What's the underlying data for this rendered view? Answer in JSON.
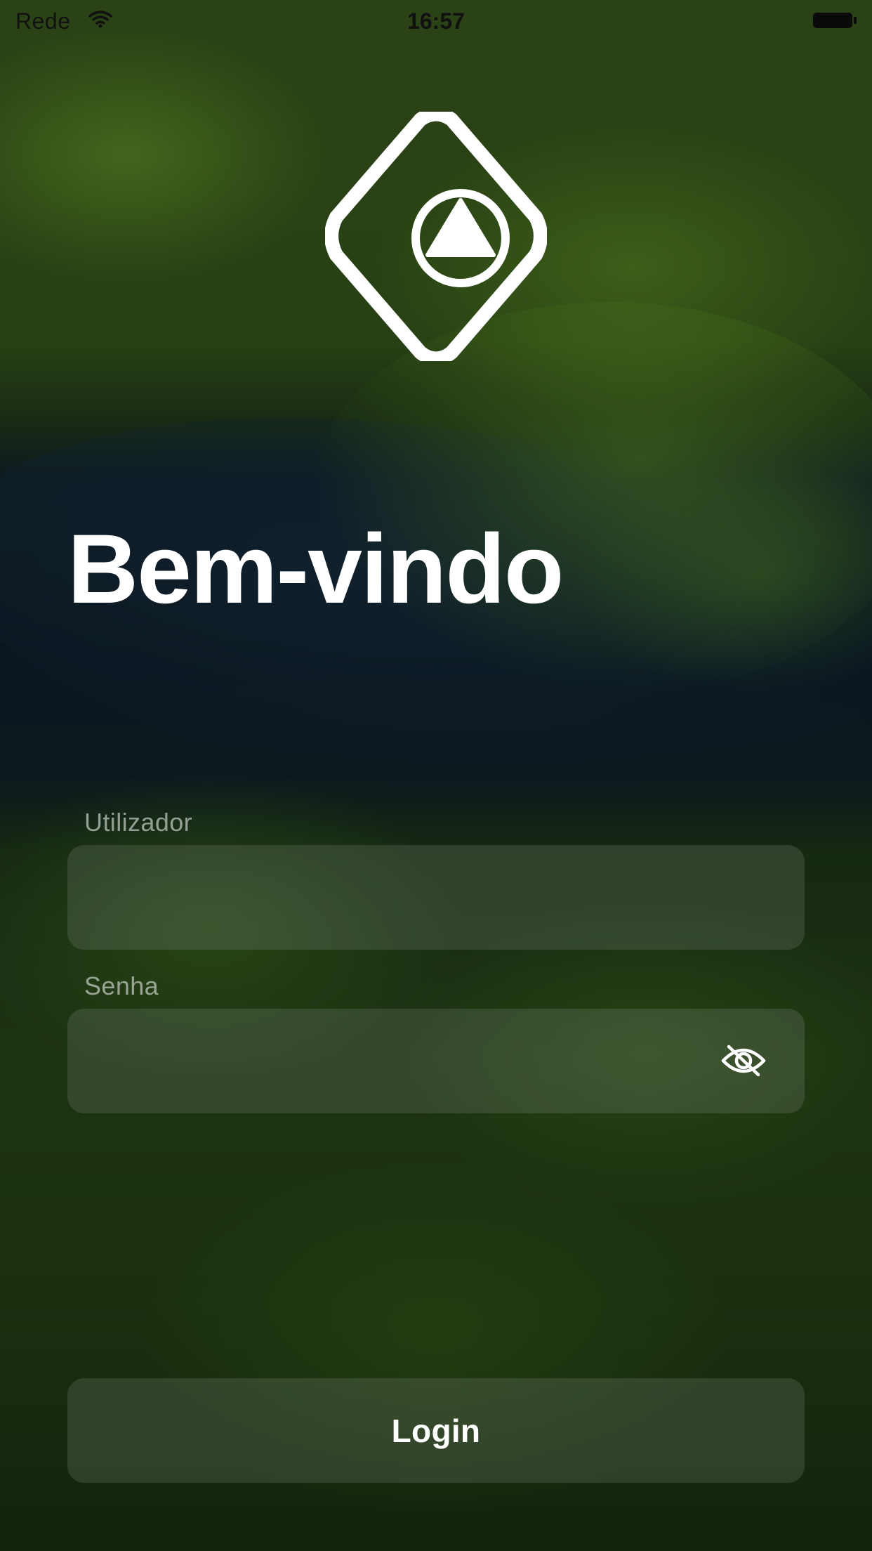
{
  "status_bar": {
    "carrier": "Rede",
    "time": "16:57",
    "wifi_icon": "wifi-icon",
    "battery_icon": "battery-icon"
  },
  "logo": {
    "icon": "diamond-triangle-logo-icon"
  },
  "title": "Bem-vindo",
  "form": {
    "username": {
      "label": "Utilizador",
      "value": ""
    },
    "password": {
      "label": "Senha",
      "value": "",
      "toggle_icon": "eye-slash-icon"
    },
    "login_label": "Login"
  },
  "colors": {
    "text": "#ffffff",
    "field_background": "rgba(140,150,140,0.22)",
    "label": "rgba(225,230,225,0.62)"
  }
}
